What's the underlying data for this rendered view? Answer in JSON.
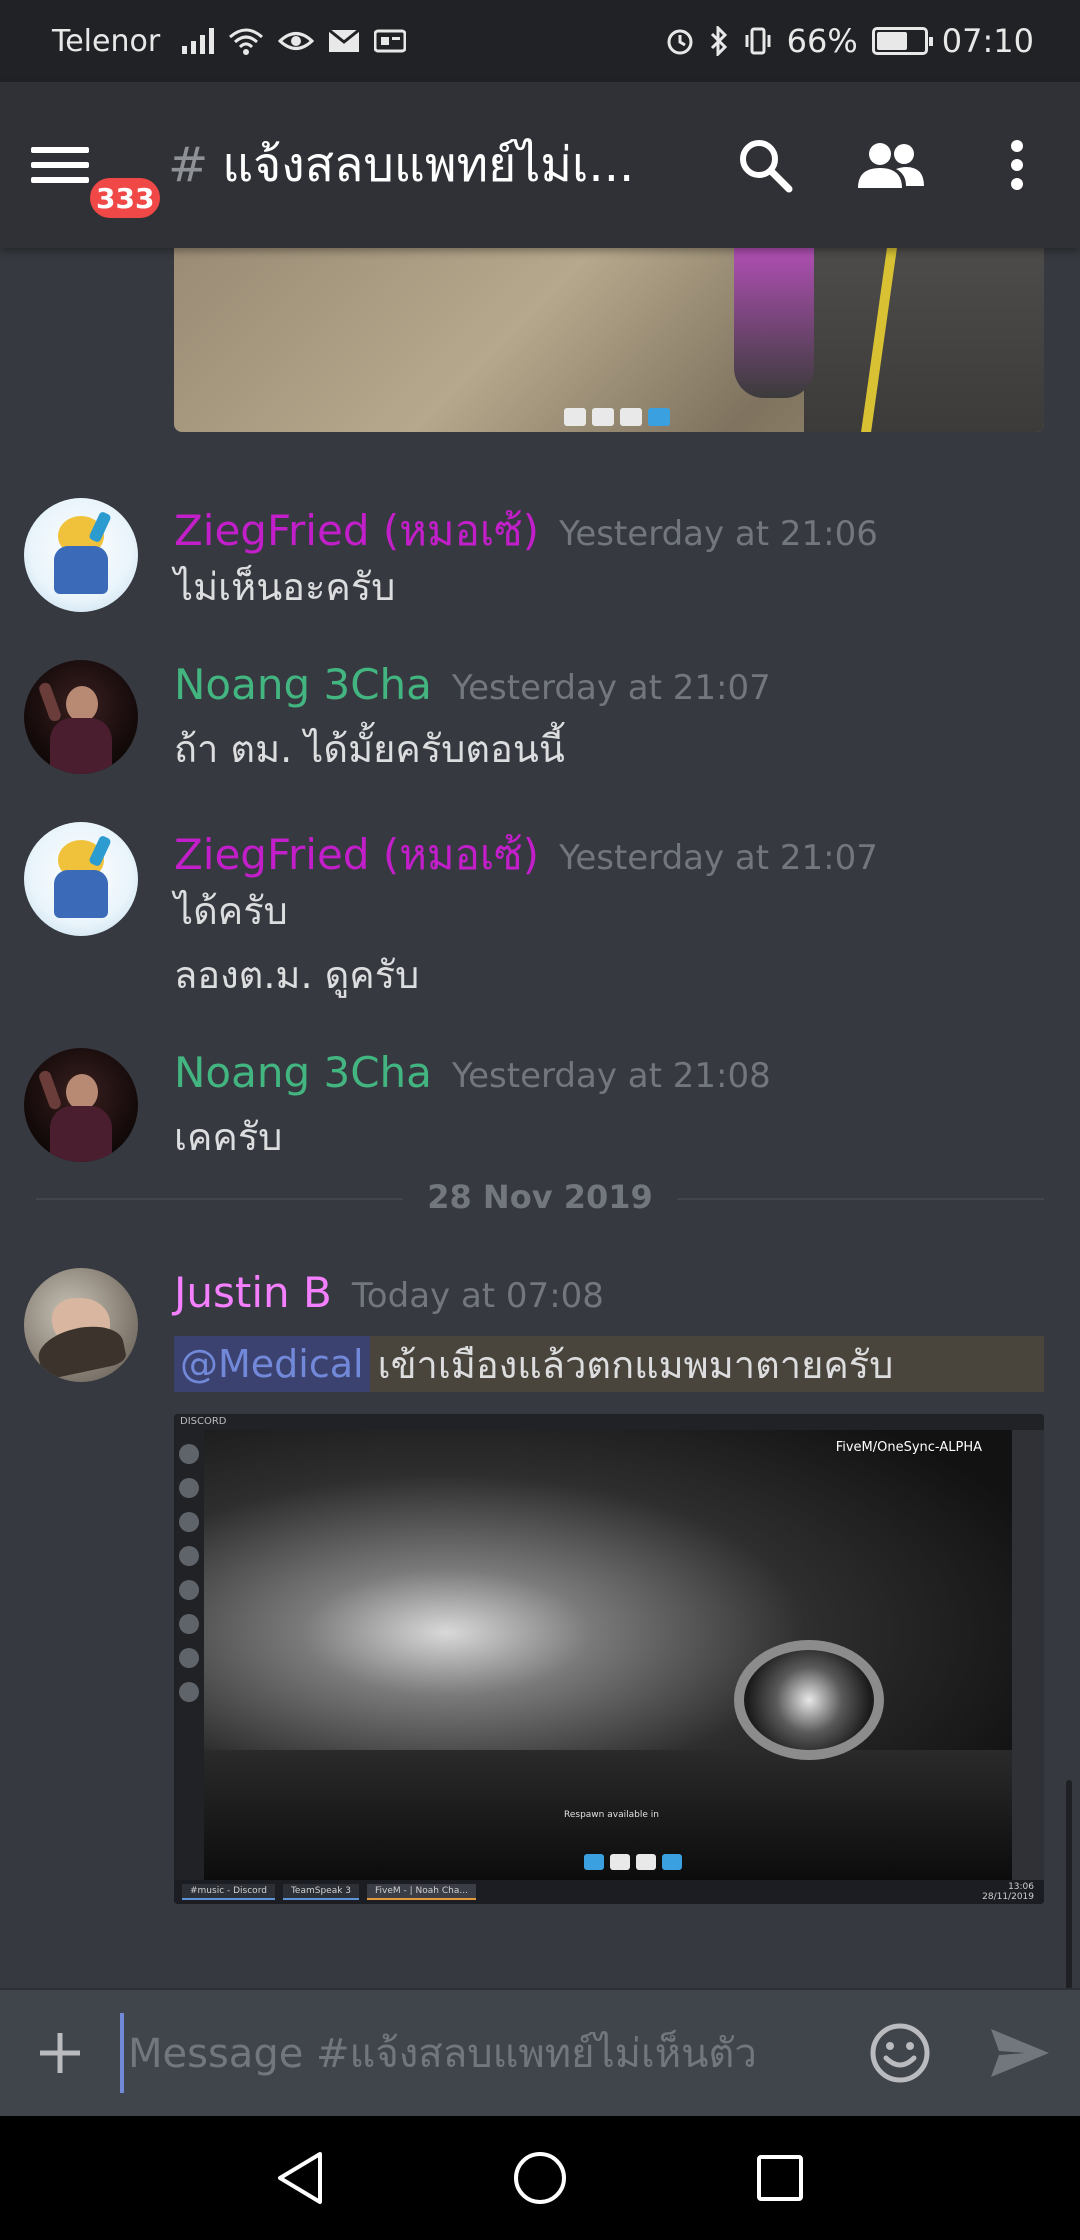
{
  "status_bar": {
    "carrier": "Telenor",
    "battery_percent": "66%",
    "battery_level": 0.66,
    "time": "07:10"
  },
  "toolbar": {
    "unread_badge": "333",
    "channel_hash": "#",
    "channel_title": "แจ้งสลบแพทย์ไม่เ..."
  },
  "messages": [
    {
      "username": "ZiegFried (หมอเซ้)",
      "color": "#c21ec9",
      "timestamp": "Yesterday at 21:06",
      "lines": [
        "ไม่เห็นอะครับ"
      ]
    },
    {
      "username": "Noang 3Cha",
      "color": "#43b581",
      "timestamp": "Yesterday at 21:07",
      "lines": [
        "ถ้า ตม. ได้มั้ยครับตอนนี้"
      ]
    },
    {
      "username": "ZiegFried (หมอเซ้)",
      "color": "#c21ec9",
      "timestamp": "Yesterday at 21:07",
      "lines": [
        "ได้ครับ",
        "ลองต.ม. ดูครับ"
      ]
    },
    {
      "username": "Noang 3Cha",
      "color": "#43b581",
      "timestamp": "Yesterday at 21:08",
      "lines": [
        "เคครับ"
      ]
    }
  ],
  "date_divider": "28 Nov 2019",
  "last_message": {
    "username": "Justin B",
    "color": "#f47fff",
    "timestamp": "Today at 07:08",
    "mention": "@Medical",
    "text": "เข้าเมืองแล้วตกแมพมาตายครับ",
    "embed": {
      "window_label": "DISCORD",
      "overlay_title": "FiveM/OneSync-ALPHA",
      "respawn_text": "Respawn available in",
      "taskbar_items": [
        "#music - Discord",
        "TeamSpeak 3",
        "FiveM - | Noah Cha..."
      ],
      "clock_time": "13:06",
      "clock_date": "28/11/2019"
    }
  },
  "composer": {
    "placeholder": "Message #แจ้งสลบแพทย์ไม่เห็นตัว"
  }
}
